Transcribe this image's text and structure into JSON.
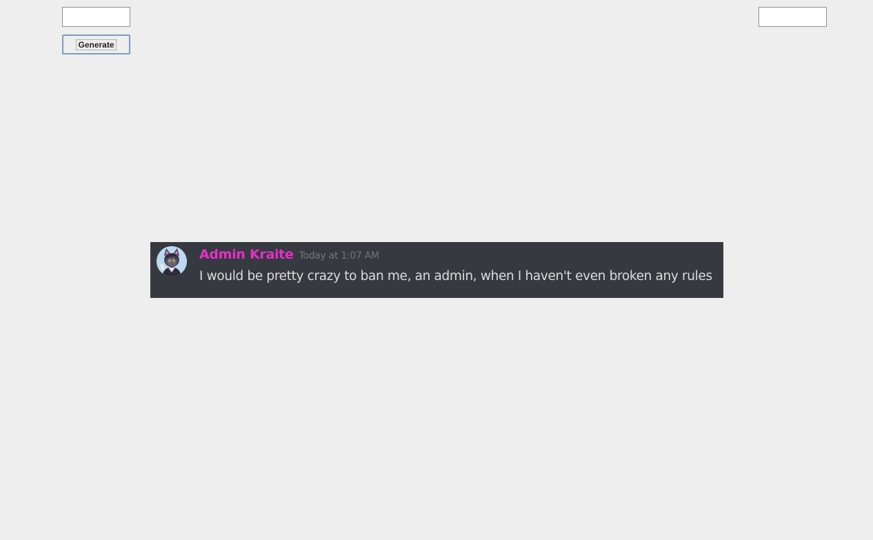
{
  "controls": {
    "left_field_value": "",
    "right_field_value": "",
    "generate_label": "Generate"
  },
  "message": {
    "username": "Admin Kraite",
    "username_color": "#e62fc9",
    "timestamp": "Today at 1:07 AM",
    "text": "I would be pretty crazy to ban me, an admin, when I haven't even broken any rules",
    "avatar_icon": "cat-avatar-icon",
    "background_color": "#36393f"
  }
}
